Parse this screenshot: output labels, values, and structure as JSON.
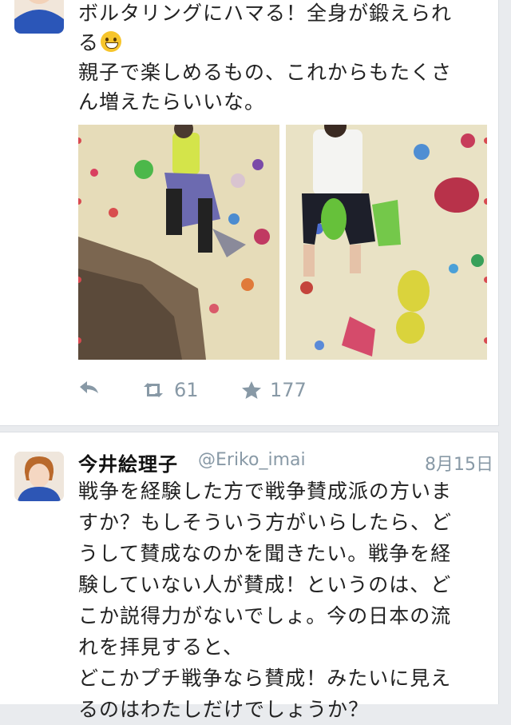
{
  "tweet1": {
    "text_line1": "ボルタリングにハマる！全身が鍛えられ",
    "text_line2_before_emoji": "る",
    "emoji": "grinning-face",
    "text_line3": "親子で楽しめるもの、これからもたくさ",
    "text_line4": "ん増えたらいいな。",
    "actions": {
      "reply_icon": "reply-icon",
      "retweet_icon": "retweet-icon",
      "retweet_count": "61",
      "favorite_icon": "star-icon",
      "favorite_count": "177"
    }
  },
  "tweet2": {
    "name": "今井絵理子",
    "handle": "@Eriko_imai",
    "date": "8月15日",
    "lines": [
      "戦争を経験した方で戦争賛成派の方いま",
      "すか？もしそういう方がいらしたら、ど",
      "うして賛成なのかを聞きたい。戦争を経",
      "験していない人が賛成！というのは、ど",
      "こか説得力がないでしょ。今の日本の流",
      "れを拝見すると、",
      "どこかプチ戦争なら賛成！みたいに見え",
      "るのはわたしだけでしょうか？"
    ]
  },
  "colors": {
    "icon_gray": "#8899a6",
    "climbing_wall": "#ebe3c6",
    "shirt_green": "#d4e44a"
  }
}
